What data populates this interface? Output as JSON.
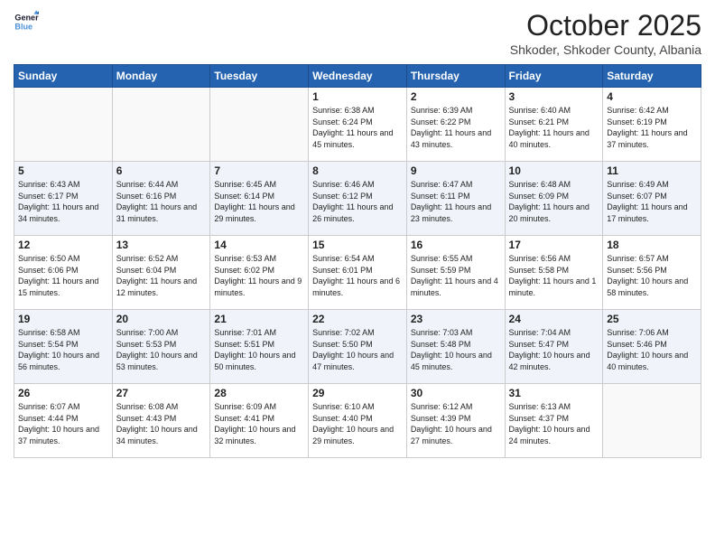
{
  "logo": {
    "line1": "General",
    "line2": "Blue"
  },
  "header": {
    "month": "October 2025",
    "location": "Shkoder, Shkoder County, Albania"
  },
  "days": [
    "Sunday",
    "Monday",
    "Tuesday",
    "Wednesday",
    "Thursday",
    "Friday",
    "Saturday"
  ],
  "weeks": [
    [
      {
        "date": "",
        "text": ""
      },
      {
        "date": "",
        "text": ""
      },
      {
        "date": "",
        "text": ""
      },
      {
        "date": "1",
        "text": "Sunrise: 6:38 AM\nSunset: 6:24 PM\nDaylight: 11 hours and 45 minutes."
      },
      {
        "date": "2",
        "text": "Sunrise: 6:39 AM\nSunset: 6:22 PM\nDaylight: 11 hours and 43 minutes."
      },
      {
        "date": "3",
        "text": "Sunrise: 6:40 AM\nSunset: 6:21 PM\nDaylight: 11 hours and 40 minutes."
      },
      {
        "date": "4",
        "text": "Sunrise: 6:42 AM\nSunset: 6:19 PM\nDaylight: 11 hours and 37 minutes."
      }
    ],
    [
      {
        "date": "5",
        "text": "Sunrise: 6:43 AM\nSunset: 6:17 PM\nDaylight: 11 hours and 34 minutes."
      },
      {
        "date": "6",
        "text": "Sunrise: 6:44 AM\nSunset: 6:16 PM\nDaylight: 11 hours and 31 minutes."
      },
      {
        "date": "7",
        "text": "Sunrise: 6:45 AM\nSunset: 6:14 PM\nDaylight: 11 hours and 29 minutes."
      },
      {
        "date": "8",
        "text": "Sunrise: 6:46 AM\nSunset: 6:12 PM\nDaylight: 11 hours and 26 minutes."
      },
      {
        "date": "9",
        "text": "Sunrise: 6:47 AM\nSunset: 6:11 PM\nDaylight: 11 hours and 23 minutes."
      },
      {
        "date": "10",
        "text": "Sunrise: 6:48 AM\nSunset: 6:09 PM\nDaylight: 11 hours and 20 minutes."
      },
      {
        "date": "11",
        "text": "Sunrise: 6:49 AM\nSunset: 6:07 PM\nDaylight: 11 hours and 17 minutes."
      }
    ],
    [
      {
        "date": "12",
        "text": "Sunrise: 6:50 AM\nSunset: 6:06 PM\nDaylight: 11 hours and 15 minutes."
      },
      {
        "date": "13",
        "text": "Sunrise: 6:52 AM\nSunset: 6:04 PM\nDaylight: 11 hours and 12 minutes."
      },
      {
        "date": "14",
        "text": "Sunrise: 6:53 AM\nSunset: 6:02 PM\nDaylight: 11 hours and 9 minutes."
      },
      {
        "date": "15",
        "text": "Sunrise: 6:54 AM\nSunset: 6:01 PM\nDaylight: 11 hours and 6 minutes."
      },
      {
        "date": "16",
        "text": "Sunrise: 6:55 AM\nSunset: 5:59 PM\nDaylight: 11 hours and 4 minutes."
      },
      {
        "date": "17",
        "text": "Sunrise: 6:56 AM\nSunset: 5:58 PM\nDaylight: 11 hours and 1 minute."
      },
      {
        "date": "18",
        "text": "Sunrise: 6:57 AM\nSunset: 5:56 PM\nDaylight: 10 hours and 58 minutes."
      }
    ],
    [
      {
        "date": "19",
        "text": "Sunrise: 6:58 AM\nSunset: 5:54 PM\nDaylight: 10 hours and 56 minutes."
      },
      {
        "date": "20",
        "text": "Sunrise: 7:00 AM\nSunset: 5:53 PM\nDaylight: 10 hours and 53 minutes."
      },
      {
        "date": "21",
        "text": "Sunrise: 7:01 AM\nSunset: 5:51 PM\nDaylight: 10 hours and 50 minutes."
      },
      {
        "date": "22",
        "text": "Sunrise: 7:02 AM\nSunset: 5:50 PM\nDaylight: 10 hours and 47 minutes."
      },
      {
        "date": "23",
        "text": "Sunrise: 7:03 AM\nSunset: 5:48 PM\nDaylight: 10 hours and 45 minutes."
      },
      {
        "date": "24",
        "text": "Sunrise: 7:04 AM\nSunset: 5:47 PM\nDaylight: 10 hours and 42 minutes."
      },
      {
        "date": "25",
        "text": "Sunrise: 7:06 AM\nSunset: 5:46 PM\nDaylight: 10 hours and 40 minutes."
      }
    ],
    [
      {
        "date": "26",
        "text": "Sunrise: 6:07 AM\nSunset: 4:44 PM\nDaylight: 10 hours and 37 minutes."
      },
      {
        "date": "27",
        "text": "Sunrise: 6:08 AM\nSunset: 4:43 PM\nDaylight: 10 hours and 34 minutes."
      },
      {
        "date": "28",
        "text": "Sunrise: 6:09 AM\nSunset: 4:41 PM\nDaylight: 10 hours and 32 minutes."
      },
      {
        "date": "29",
        "text": "Sunrise: 6:10 AM\nSunset: 4:40 PM\nDaylight: 10 hours and 29 minutes."
      },
      {
        "date": "30",
        "text": "Sunrise: 6:12 AM\nSunset: 4:39 PM\nDaylight: 10 hours and 27 minutes."
      },
      {
        "date": "31",
        "text": "Sunrise: 6:13 AM\nSunset: 4:37 PM\nDaylight: 10 hours and 24 minutes."
      },
      {
        "date": "",
        "text": ""
      }
    ]
  ]
}
